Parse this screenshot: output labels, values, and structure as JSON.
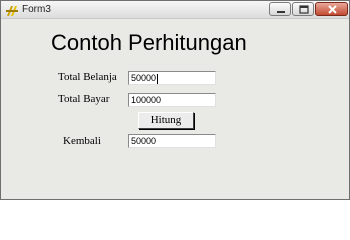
{
  "window": {
    "title": "Form3",
    "icon": "vb-form-icon",
    "controls": [
      "minimize-icon",
      "maximize-icon",
      "close-icon"
    ]
  },
  "form": {
    "heading": "Contoh Perhitungan",
    "total_belanja_label": "Total Belanja",
    "total_belanja_value": "50000",
    "total_bayar_label": "Total Bayar",
    "total_bayar_value": "100000",
    "hitung_button": "Hitung",
    "kembali_label": "Kembali",
    "kembali_value": "50000"
  }
}
